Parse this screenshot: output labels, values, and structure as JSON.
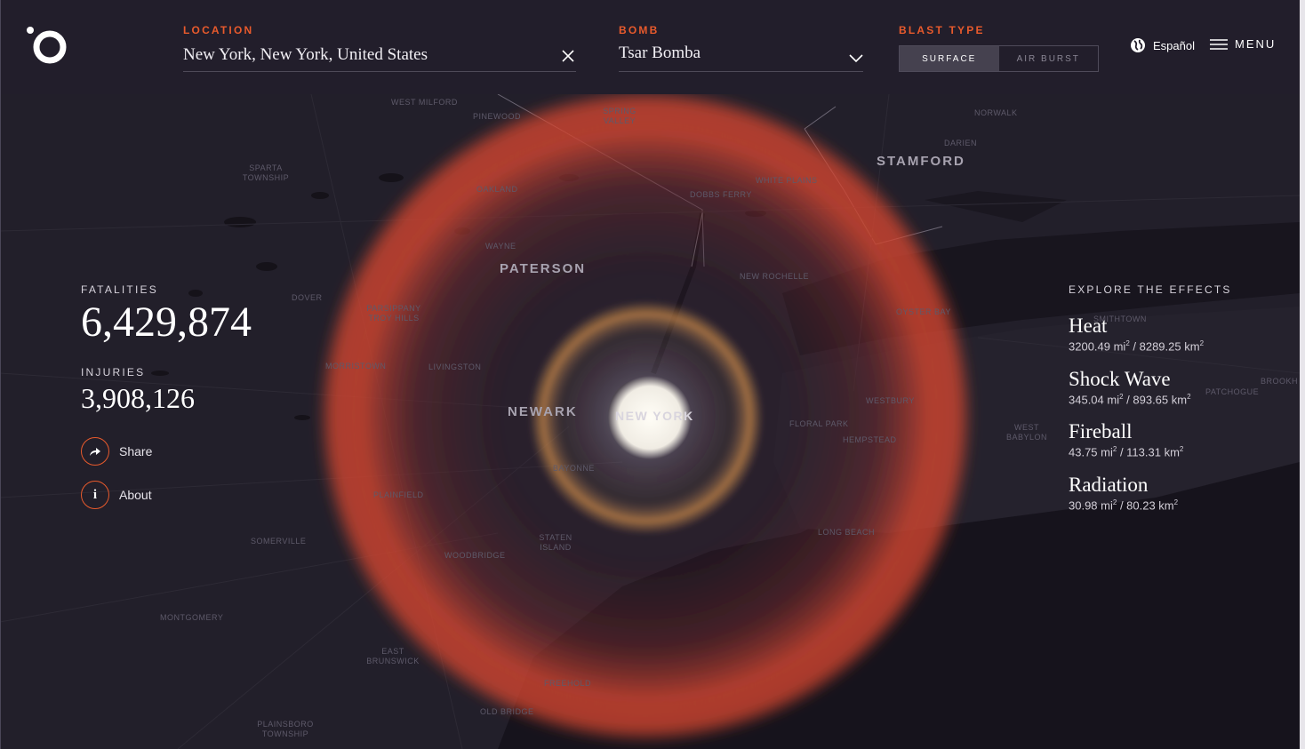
{
  "header": {
    "location_label": "LOCATION",
    "location_value": "New York, New York, United States",
    "bomb_label": "BOMB",
    "bomb_value": "Tsar Bomba",
    "blast_label": "BLAST TYPE",
    "blast_options": [
      "SURFACE",
      "AIR BURST"
    ],
    "blast_selected": "SURFACE",
    "language": "Español",
    "menu": "MENU"
  },
  "stats": {
    "fatalities_label": "FATALITIES",
    "fatalities_value": "6,429,874",
    "injuries_label": "INJURIES",
    "injuries_value": "3,908,126",
    "share_label": "Share",
    "about_label": "About"
  },
  "effects": {
    "heading": "EXPLORE THE EFFECTS",
    "items": [
      {
        "name": "Heat",
        "mi": "3200.49 mi",
        "km": " / 8289.25 km"
      },
      {
        "name": "Shock Wave",
        "mi": "345.04 mi",
        "km": " / 893.65 km"
      },
      {
        "name": "Fireball",
        "mi": "43.75 mi",
        "km": " / 113.31 km"
      },
      {
        "name": "Radiation",
        "mi": "30.98 mi",
        "km": " / 80.23 km"
      }
    ]
  },
  "map": {
    "cities": {
      "new_york": "NEW YORK",
      "newark": "NEWARK",
      "paterson": "PATERSON",
      "stamford": "STAMFORD"
    },
    "towns": {
      "west_milford": "WEST MILFORD",
      "pinewood": "PINEWOOD",
      "spring_valley": "SPRING VALLEY",
      "norwalk": "NORWALK",
      "darien": "DARIEN",
      "sparta": "SPARTA TOWNSHIP",
      "oakland": "OAKLAND",
      "dobbs_ferry": "DOBBS FERRY",
      "white_plains": "WHITE PLAINS",
      "wayne": "WAYNE",
      "dover": "DOVER",
      "new_rochelle": "NEW ROCHELLE",
      "parsippany": "PARSIPPANY TROY HILLS",
      "oyster_bay": "OYSTER BAY",
      "smithtown": "SMITHTOWN",
      "morristown": "MORRISTOWN",
      "livingston": "LIVINGSTON",
      "patchogue": "PATCHOGUE",
      "brookhaven": "BROOKH",
      "westbury": "WESTBURY",
      "floral_park": "FLORAL PARK",
      "hempstead": "HEMPSTEAD",
      "west_babylon": "WEST BABYLON",
      "bayonne": "BAYONNE",
      "plainfield": "PLAINFIELD",
      "staten_island": "STATEN ISLAND",
      "long_beach": "LONG BEACH",
      "somerville": "SOMERVILLE",
      "woodbridge": "WOODBRIDGE",
      "montgomery": "MONTGOMERY",
      "east_brunswick": "EAST BRUNSWICK",
      "freehold": "FREEHOLD",
      "old_bridge": "OLD BRIDGE",
      "plainsboro": "PLAINSBORO TOWNSHIP"
    }
  },
  "colors": {
    "accent": "#e85a2c",
    "heat": "#d9482f",
    "fireball": "#f3efe6",
    "shock": "#c8874a",
    "background": "#1b1822"
  }
}
